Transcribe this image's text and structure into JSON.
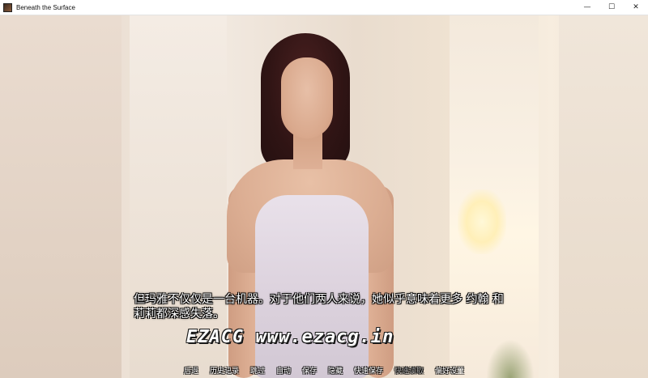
{
  "window": {
    "title": "Beneath the Surface",
    "controls": {
      "minimize": "—",
      "maximize": "☐",
      "close": "✕"
    }
  },
  "dialogue": {
    "text": "但玛雅不仅仅是一台机器。对于他们两人来说，她似乎意味着更多 约翰 和莉莉都深感失落。"
  },
  "watermark": {
    "text": "EZACG www.ezacg.in"
  },
  "quick_menu": {
    "items": [
      {
        "label": "后退",
        "enabled": true
      },
      {
        "label": "历史记录",
        "enabled": true
      },
      {
        "label": "跳过",
        "enabled": true
      },
      {
        "label": "自动",
        "enabled": true
      },
      {
        "label": "保存",
        "enabled": true
      },
      {
        "label": "隐藏",
        "enabled": true
      },
      {
        "label": "快速保存",
        "enabled": true
      },
      {
        "label": "快速读取",
        "enabled": false
      },
      {
        "label": "偏好设置",
        "enabled": true
      }
    ]
  },
  "colors": {
    "dialogue_text": "#ffffff",
    "quick_menu_active": "#ffffff",
    "quick_menu_disabled": "#9a9a9a"
  }
}
